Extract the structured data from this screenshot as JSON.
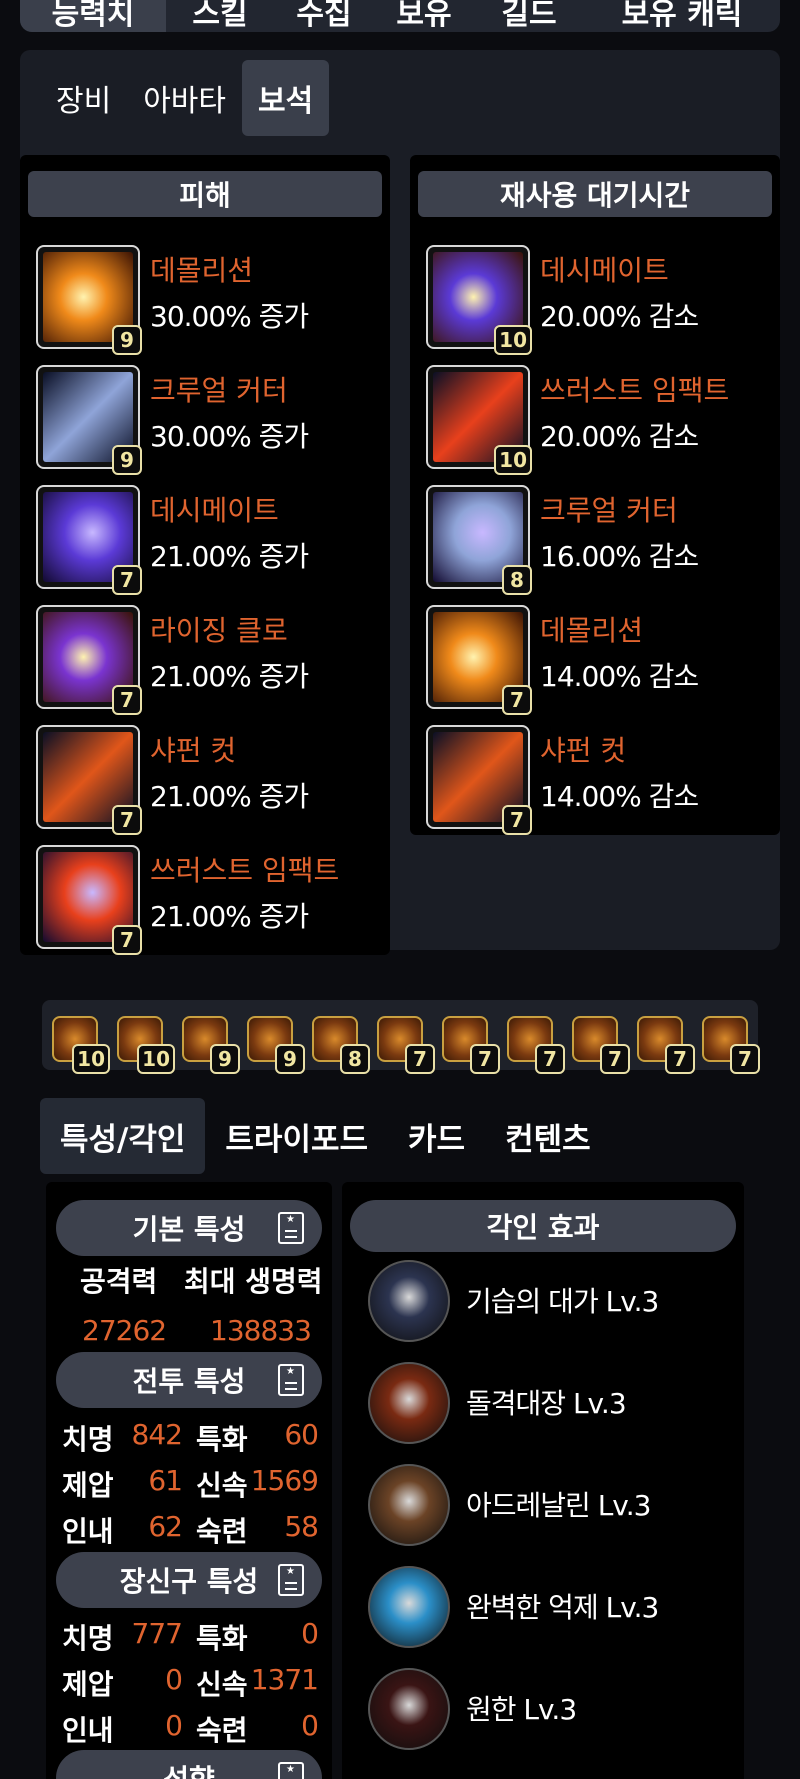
{
  "top_tabs": [
    "능력치",
    "스킬",
    "수집",
    "보유",
    "길드",
    "보유 캐릭"
  ],
  "sub_tabs": [
    "장비",
    "아바타",
    "보석"
  ],
  "damage_column": {
    "header": "피해",
    "gems": [
      {
        "name": "데몰리션",
        "effect": "30.00% 증가",
        "level": "9",
        "icon": "demolition-skill-icon",
        "color": "#f08a1a"
      },
      {
        "name": "크루얼 커터",
        "effect": "30.00% 증가",
        "level": "9",
        "icon": "cruel-cutter-skill-icon",
        "color": "#8fa4d8"
      },
      {
        "name": "데시메이트",
        "effect": "21.00% 증가",
        "level": "7",
        "icon": "decimate-skill-icon",
        "color": "#5b3ad6"
      },
      {
        "name": "라이징 클로",
        "effect": "21.00% 증가",
        "level": "7",
        "icon": "rising-claw-skill-icon",
        "color": "#7a34d0"
      },
      {
        "name": "샤펀 컷",
        "effect": "21.00% 증가",
        "level": "7",
        "icon": "sharpen-cut-skill-icon",
        "color": "#e0561a"
      },
      {
        "name": "쓰러스트 임팩트",
        "effect": "21.00% 증가",
        "level": "7",
        "icon": "thrust-impact-skill-icon",
        "color": "#e8401c"
      }
    ]
  },
  "cooldown_column": {
    "header": "재사용 대기시간",
    "gems": [
      {
        "name": "데시메이트",
        "effect": "20.00% 감소",
        "level": "10",
        "icon": "decimate-skill-icon",
        "color": "#5b3ad6"
      },
      {
        "name": "쓰러스트 임팩트",
        "effect": "20.00% 감소",
        "level": "10",
        "icon": "thrust-impact-skill-icon",
        "color": "#e8401c"
      },
      {
        "name": "크루얼 커터",
        "effect": "16.00% 감소",
        "level": "8",
        "icon": "cruel-cutter-skill-icon",
        "color": "#8fa4d8"
      },
      {
        "name": "데몰리션",
        "effect": "14.00% 감소",
        "level": "7",
        "icon": "demolition-skill-icon",
        "color": "#f08a1a"
      },
      {
        "name": "샤펀 컷",
        "effect": "14.00% 감소",
        "level": "7",
        "icon": "sharpen-cut-skill-icon",
        "color": "#e0561a"
      }
    ]
  },
  "gem_strip": [
    "10",
    "10",
    "9",
    "9",
    "8",
    "7",
    "7",
    "7",
    "7",
    "7",
    "7"
  ],
  "lower_tabs": [
    "특성/각인",
    "트라이포드",
    "카드",
    "컨텐츠"
  ],
  "basic_stats": {
    "header": "기본 특성",
    "attack_label": "공격력",
    "attack_value": "27262",
    "hp_label": "최대 생명력",
    "hp_value": "138833"
  },
  "combat_stats": {
    "header": "전투 특성",
    "rows": [
      {
        "k1": "치명",
        "v1": "842",
        "k2": "특화",
        "v2": "60"
      },
      {
        "k1": "제압",
        "v1": "61",
        "k2": "신속",
        "v2": "1569"
      },
      {
        "k1": "인내",
        "v1": "62",
        "k2": "숙련",
        "v2": "58"
      }
    ]
  },
  "accessory_stats": {
    "header": "장신구 특성",
    "rows": [
      {
        "k1": "치명",
        "v1": "777",
        "k2": "특화",
        "v2": "0"
      },
      {
        "k1": "제압",
        "v1": "0",
        "k2": "신속",
        "v2": "1371"
      },
      {
        "k1": "인내",
        "v1": "0",
        "k2": "숙련",
        "v2": "0"
      }
    ]
  },
  "tendency_header": "성향",
  "engravings": {
    "header": "각인 효과",
    "items": [
      {
        "name": "기습의 대가 Lv.3",
        "icon": "master-ambusher-icon",
        "color": "#2c3450"
      },
      {
        "name": "돌격대장 Lv.3",
        "icon": "raid-captain-icon",
        "color": "#7a2a12"
      },
      {
        "name": "아드레날린 Lv.3",
        "icon": "adrenaline-icon",
        "color": "#6b4326"
      },
      {
        "name": "완벽한 억제 Lv.3",
        "icon": "perfect-suppression-icon",
        "color": "#2b8fc8"
      },
      {
        "name": "원한 Lv.3",
        "icon": "grudge-icon",
        "color": "#3a1414"
      }
    ]
  }
}
